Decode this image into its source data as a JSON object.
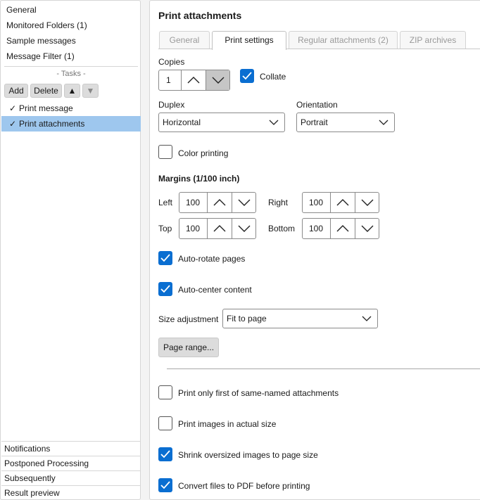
{
  "sidebar": {
    "nav": [
      "General",
      "Monitored Folders (1)",
      "Sample messages",
      "Message Filter (1)"
    ],
    "tasks_label": "- Tasks -",
    "buttons": {
      "add": "Add",
      "delete": "Delete",
      "up": "▲",
      "down": "▼"
    },
    "tasks": [
      {
        "check": "✓",
        "label": "Print message"
      },
      {
        "check": "✓",
        "label": "Print attachments"
      }
    ],
    "bottom": [
      "Notifications",
      "Postponed Processing",
      "Subsequently",
      "Result preview"
    ]
  },
  "panel": {
    "title": "Print attachments",
    "tabs": [
      "General",
      "Print settings",
      "Regular attachments (2)",
      "ZIP archives"
    ],
    "active_tab": "Print settings",
    "copies_label": "Copies",
    "copies_value": "1",
    "collate_label": "Collate",
    "duplex_label": "Duplex",
    "duplex_value": "Horizontal",
    "orientation_label": "Orientation",
    "orientation_value": "Portrait",
    "color_label": "Color printing",
    "margins_label": "Margins (1/100 inch)",
    "margins": {
      "left_label": "Left",
      "left": "100",
      "right_label": "Right",
      "right": "100",
      "top_label": "Top",
      "top": "100",
      "bottom_label": "Bottom",
      "bottom": "100"
    },
    "auto_rotate_label": "Auto-rotate pages",
    "auto_center_label": "Auto-center content",
    "size_label": "Size adjustment",
    "size_value": "Fit to page",
    "page_range_label": "Page range...",
    "opts": {
      "first_named": "Print only first of same-named attachments",
      "actual_size": "Print images in actual size",
      "shrink": "Shrink oversized images to page size",
      "pdf": "Convert files to PDF before printing"
    }
  },
  "state": {
    "collate": true,
    "color": false,
    "auto_rotate": true,
    "auto_center": true,
    "first_named": false,
    "actual_size": false,
    "shrink": true,
    "pdf": true
  },
  "colors": {
    "accent": "#0a6ed1",
    "selected_row": "#9ec7ee"
  }
}
